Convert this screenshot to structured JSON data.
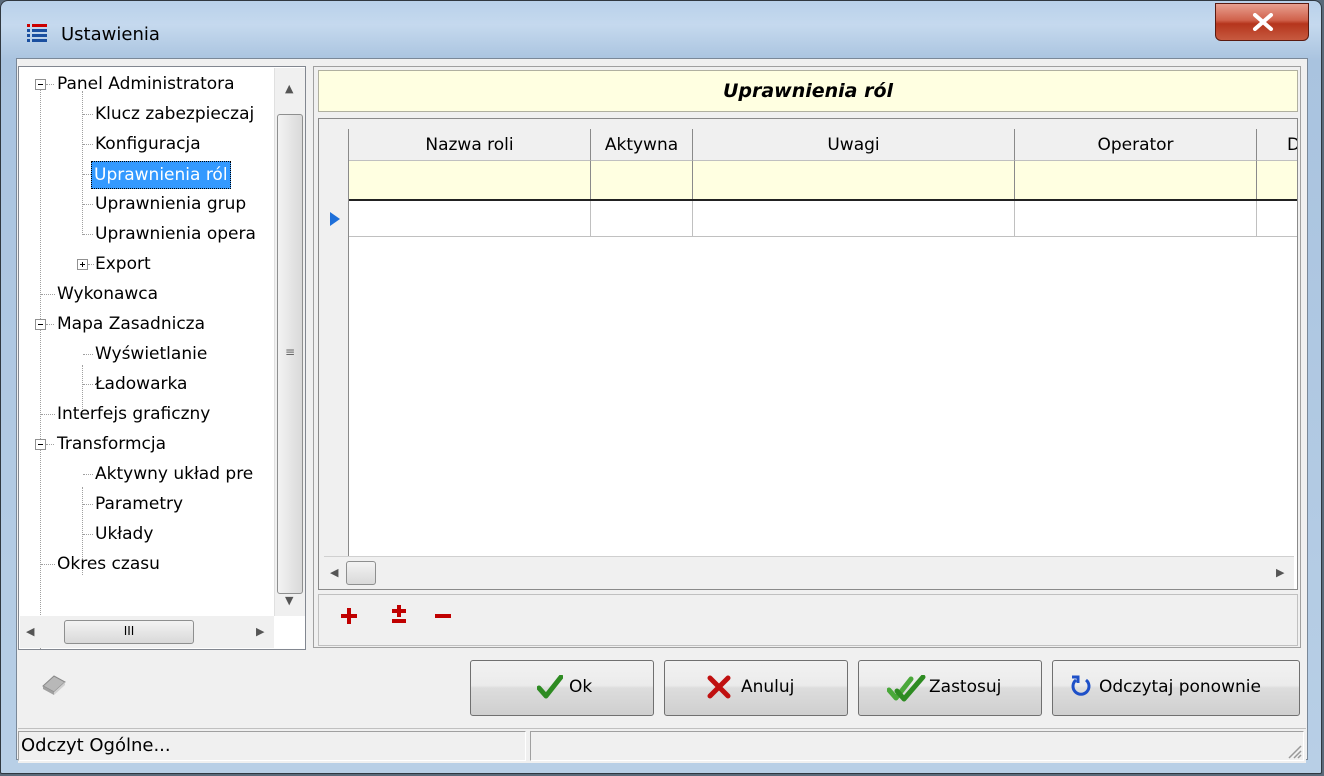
{
  "window": {
    "title": "Ustawienia"
  },
  "tree": {
    "items": [
      {
        "label": "Panel Administratora"
      },
      {
        "label": "Klucz zabezpieczaj"
      },
      {
        "label": "Konfiguracja"
      },
      {
        "label": "Uprawnienia ról"
      },
      {
        "label": "Uprawnienia grup"
      },
      {
        "label": "Uprawnienia opera"
      },
      {
        "label": "Export"
      },
      {
        "label": "Wykonawca"
      },
      {
        "label": "Mapa Zasadnicza"
      },
      {
        "label": "Wyświetlanie"
      },
      {
        "label": "Ładowarka"
      },
      {
        "label": "Interfejs graficzny"
      },
      {
        "label": "Transformcja"
      },
      {
        "label": "Aktywny układ pre"
      },
      {
        "label": "Parametry"
      },
      {
        "label": "Układy"
      },
      {
        "label": "Okres czasu"
      }
    ],
    "hscroll_glyph": "III"
  },
  "panel": {
    "title": "Uprawnienia ról"
  },
  "grid": {
    "columns": [
      {
        "label": "Nazwa roli"
      },
      {
        "label": "Aktywna"
      },
      {
        "label": "Uwagi"
      },
      {
        "label": "Operator"
      },
      {
        "label": "D"
      }
    ]
  },
  "buttons": {
    "ok": "Ok",
    "cancel": "Anuluj",
    "apply": "Zastosuj",
    "reload": "Odczytaj ponownie"
  },
  "status": {
    "text": "Odczyt Ogólne..."
  },
  "colors": {
    "accent": "#3399ff",
    "header_bg": "#ffffe1",
    "toolbar_icon": "#c00000",
    "check": "#2e8b22"
  }
}
